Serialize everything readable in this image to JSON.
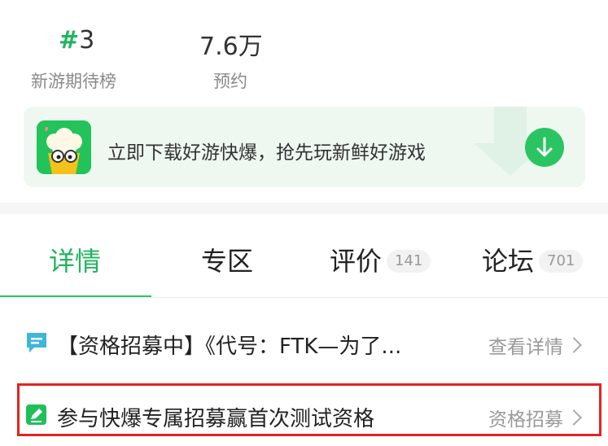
{
  "stats": [
    {
      "hash": "#",
      "value": "3",
      "label": "新游期待榜"
    },
    {
      "value": "7.6万",
      "label": "预约"
    }
  ],
  "banner": {
    "text": "立即下载好游快爆，抢先玩新鲜好游戏",
    "icon": "popcorn-mascot-icon",
    "button_icon": "download-arrow-icon"
  },
  "tabs": [
    {
      "label": "详情",
      "active": true
    },
    {
      "label": "专区"
    },
    {
      "label": "评价",
      "count": "141"
    },
    {
      "label": "论坛",
      "count": "701"
    }
  ],
  "rows": [
    {
      "icon": "message-icon",
      "text": "【资格招募中】《代号：FTK—为了...",
      "link": "查看详情"
    },
    {
      "icon": "edit-icon",
      "text": "参与快爆专属招募赢首次测试资格",
      "link": "资格招募"
    }
  ],
  "colors": {
    "accent": "#2bc463",
    "highlight_border": "#e0251f"
  }
}
